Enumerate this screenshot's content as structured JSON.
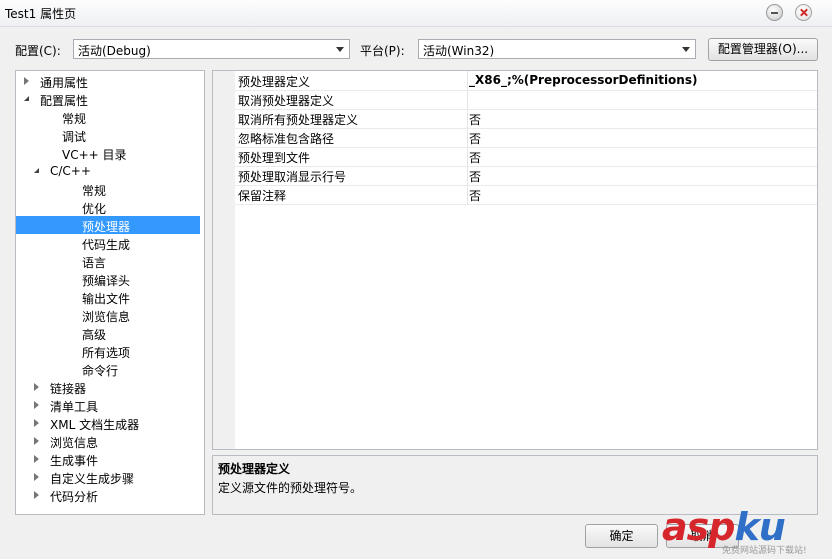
{
  "window": {
    "title": "Test1 属性页"
  },
  "toolbar": {
    "config_label": "配置(C):",
    "config_value": "活动(Debug)",
    "platform_label": "平台(P):",
    "platform_value": "活动(Win32)",
    "config_manager_button": "配置管理器(O)..."
  },
  "tree": {
    "items": [
      {
        "label": "通用属性",
        "expander": "closed"
      },
      {
        "label": "配置属性",
        "expander": "open"
      },
      {
        "label": "常规"
      },
      {
        "label": "调试"
      },
      {
        "label": "VC++ 目录"
      },
      {
        "label": "C/C++",
        "expander": "open"
      },
      {
        "label": "常规"
      },
      {
        "label": "优化"
      },
      {
        "label": "预处理器",
        "selected": true
      },
      {
        "label": "代码生成"
      },
      {
        "label": "语言"
      },
      {
        "label": "预编译头"
      },
      {
        "label": "输出文件"
      },
      {
        "label": "浏览信息"
      },
      {
        "label": "高级"
      },
      {
        "label": "所有选项"
      },
      {
        "label": "命令行"
      },
      {
        "label": "链接器",
        "expander": "closed"
      },
      {
        "label": "清单工具",
        "expander": "closed"
      },
      {
        "label": "XML 文档生成器",
        "expander": "closed"
      },
      {
        "label": "浏览信息",
        "expander": "closed"
      },
      {
        "label": "生成事件",
        "expander": "closed"
      },
      {
        "label": "自定义生成步骤",
        "expander": "closed"
      },
      {
        "label": "代码分析",
        "expander": "closed"
      }
    ]
  },
  "grid": {
    "rows": [
      {
        "name": "预处理器定义",
        "value": "_X86_;%(PreprocessorDefinitions)"
      },
      {
        "name": "取消预处理器定义",
        "value": ""
      },
      {
        "name": "取消所有预处理器定义",
        "value": "否"
      },
      {
        "name": "忽略标准包含路径",
        "value": "否"
      },
      {
        "name": "预处理到文件",
        "value": "否"
      },
      {
        "name": "预处理取消显示行号",
        "value": "否"
      },
      {
        "name": "保留注释",
        "value": "否"
      }
    ]
  },
  "description": {
    "title": "预处理器定义",
    "text": "定义源文件的预处理符号。"
  },
  "buttons": {
    "ok": "确定",
    "partial": "取消"
  },
  "watermark": {
    "brand_a": "asp",
    "brand_b": "ku",
    "brand_c": "",
    "tagline": "免费网站源码下载站!"
  }
}
